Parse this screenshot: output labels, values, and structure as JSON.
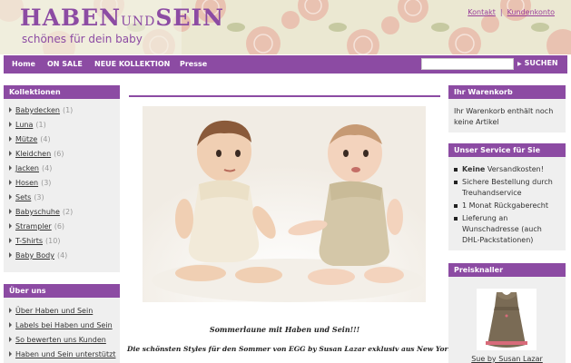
{
  "header": {
    "logo_main": "HABEN",
    "logo_und": "UND",
    "logo_sein": "SEIN",
    "logo_sub": "schönes für dein baby",
    "links": [
      "Kontakt",
      "Kundenkonto"
    ],
    "sep": "|"
  },
  "nav": {
    "items": [
      "Home",
      "ON SALE",
      "NEUE KOLLEKTION",
      "Presse"
    ],
    "search_placeholder": "",
    "search_label": "SUCHEN"
  },
  "kollektionen": {
    "title": "Kollektionen",
    "items": [
      {
        "label": "Babydecken",
        "count": "(1)"
      },
      {
        "label": "Luna",
        "count": "(1)"
      },
      {
        "label": "Mütze",
        "count": "(4)"
      },
      {
        "label": "Kleidchen",
        "count": "(6)"
      },
      {
        "label": "Jacken",
        "count": "(4)"
      },
      {
        "label": "Hosen",
        "count": "(3)"
      },
      {
        "label": "Sets",
        "count": "(3)"
      },
      {
        "label": "Babyschuhe",
        "count": "(2)"
      },
      {
        "label": "Strampler",
        "count": "(6)"
      },
      {
        "label": "T-Shirts",
        "count": "(10)"
      },
      {
        "label": "Baby Body",
        "count": "(4)"
      }
    ]
  },
  "ueber_uns": {
    "title": "Über uns",
    "items": [
      "Über Haben und Sein",
      "Labels bei Haben und Sein",
      "So bewerten uns Kunden",
      "Haben und Sein unterstützt"
    ]
  },
  "warenkorb": {
    "title": "Ihr Warenkorb",
    "text": "Ihr Warenkorb enthält noch keine Artikel"
  },
  "service": {
    "title": "Unser Service für Sie",
    "items": [
      {
        "bold": "Keine",
        "text": " Versandkosten!"
      },
      {
        "bold": "",
        "text": "Sichere Bestellung durch Treuhandservice"
      },
      {
        "bold": "",
        "text": "1 Monat Rückgaberecht"
      },
      {
        "bold": "",
        "text": "Lieferung an Wunschadresse (auch DHL-Packstationen)"
      }
    ]
  },
  "preisknaller": {
    "title": "Preisknaller",
    "product_name": "Sue by Susan Lazar"
  },
  "main": {
    "caption1": "Sommerlaune mit Haben und Sein!!!",
    "caption2": "Die schönsten Styles für den Sommer von EGG by Susan Lazar exklusiv aus New York!"
  },
  "colors": {
    "accent": "#8c4ba3",
    "sidebar_bg": "#efefef"
  }
}
